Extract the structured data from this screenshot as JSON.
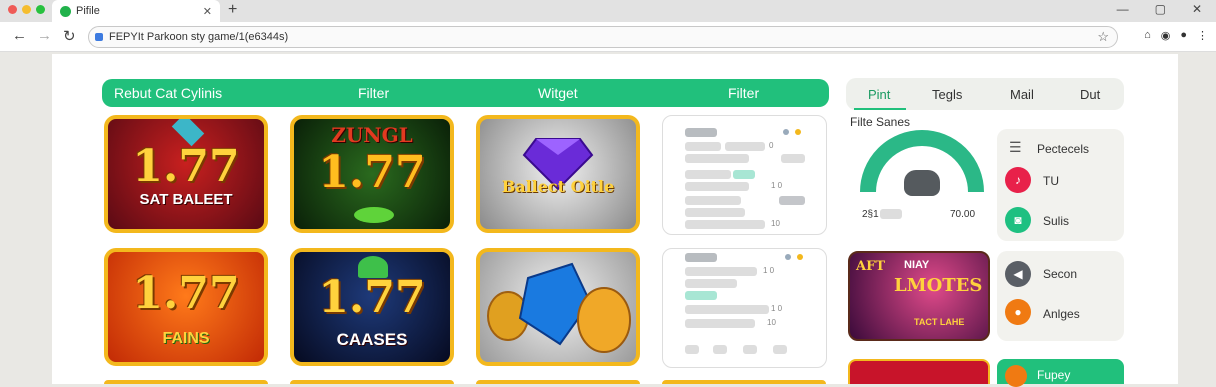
{
  "browser": {
    "tab_title": "Pifile",
    "tab_close": "✕",
    "new_tab": "+",
    "url": "FEPYIt Parkoon sty game/1(e6344s)"
  },
  "filterbar": {
    "items": [
      "Rebut Cat Cylinis",
      "Filter",
      "Witget",
      "Filter"
    ]
  },
  "games": [
    {
      "big": "1.77",
      "sub": "SAT BALEET"
    },
    {
      "top": "ZUNGL",
      "big": "1.77"
    },
    {
      "sub": "Ballect Oitle"
    },
    {
      "big": "1.77",
      "sub": "FAINS"
    },
    {
      "big": "1.77",
      "sub": "CAASES"
    },
    {}
  ],
  "panel_marks": [
    "0",
    "1 0",
    "10",
    "1 0",
    "1 0",
    "10"
  ],
  "sidebar": {
    "tabs": [
      "Pint",
      "Tegls",
      "Mail",
      "Dut"
    ],
    "gauge_title": "Filte Sanes",
    "gauge_min": "2§1",
    "gauge_max": "70.00",
    "items_a": [
      {
        "icon": "list-icon",
        "label": "Pectecels"
      },
      {
        "icon": "music-icon",
        "label": "TU"
      },
      {
        "icon": "chat-icon",
        "label": "Sulis"
      }
    ],
    "promo": {
      "line1": "AFT",
      "line2": "NIAY",
      "line3": "LMOTES",
      "line4": "TACT LAHE"
    },
    "items_b": [
      {
        "icon": "speaker-icon",
        "label": "Secon"
      },
      {
        "icon": "location-icon",
        "label": "Anlges"
      }
    ],
    "partial_label": "Fupey"
  },
  "colors": {
    "accent": "#21c07c",
    "gold": "#f3b81d"
  }
}
